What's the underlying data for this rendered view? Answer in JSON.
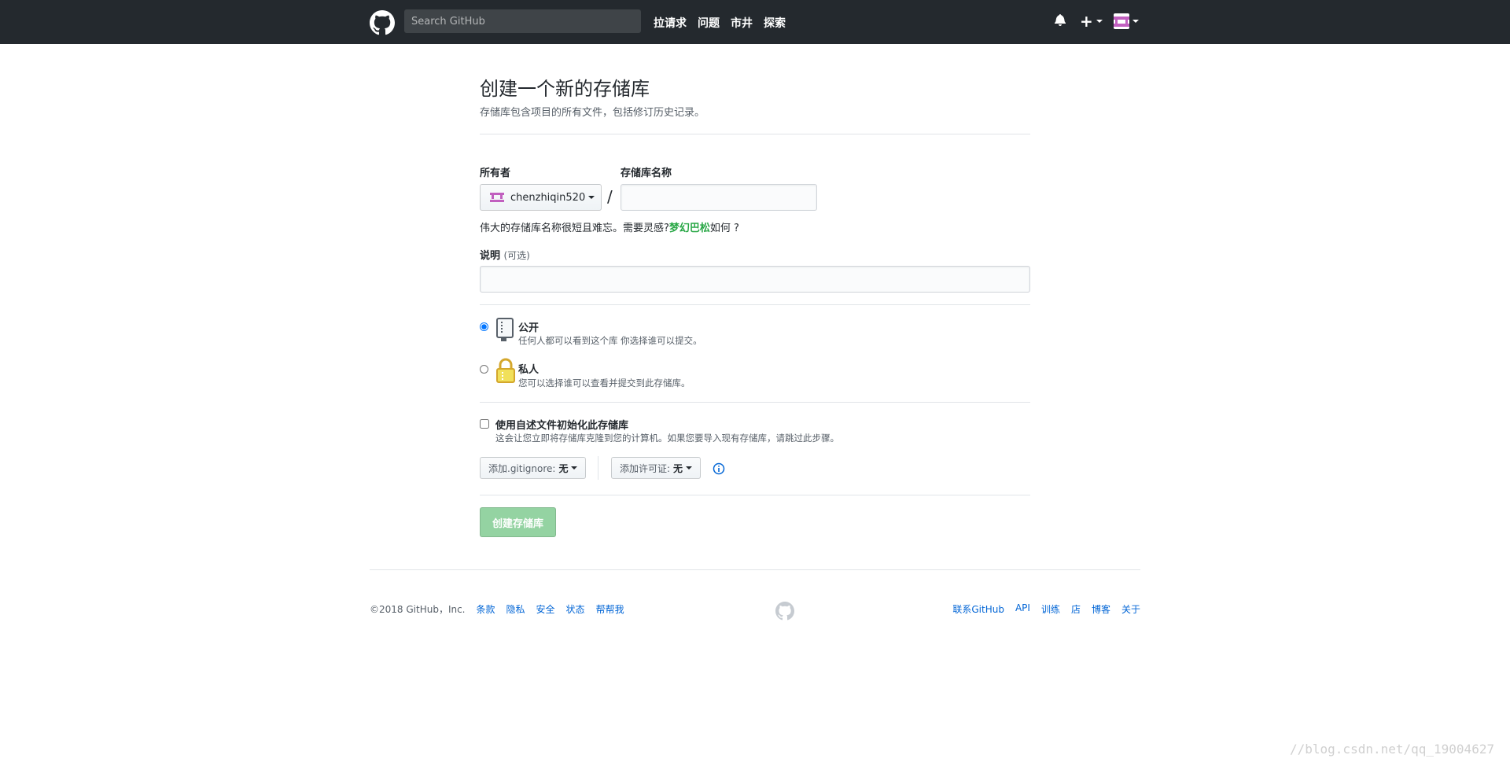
{
  "header": {
    "search_placeholder": "Search GitHub",
    "nav": [
      "拉请求",
      "问题",
      "市井",
      "探索"
    ]
  },
  "page": {
    "title": "创建一个新的存储库",
    "subtitle": "存储库包含项目的所有文件，包括修订历史记录。"
  },
  "form": {
    "owner_label": "所有者",
    "owner_value": "chenzhiqin520",
    "slash": "/",
    "repo_name_label": "存储库名称",
    "repo_name_value": "",
    "hint_prefix": "伟大的存储库名称很短且难忘。需要灵感?",
    "hint_suggestion": "梦幻巴松",
    "hint_suffix": "如何 ?",
    "description_label": "说明",
    "description_optional": "(可选)",
    "description_value": "",
    "public_label": "公开",
    "public_note": "任何人都可以看到这个库 你选择谁可以提交。",
    "public_selected": true,
    "private_label": "私人",
    "private_note": "您可以选择谁可以查看并提交到此存储库。",
    "init_label": "使用自述文件初始化此存储库",
    "init_note": "这会让您立即将存储库克隆到您的计算机。如果您要导入现有存储库，请跳过此步骤。",
    "init_checked": false,
    "gitignore_label": "添加.gitignore:",
    "gitignore_value": "无",
    "license_label": "添加许可证:",
    "license_value": "无",
    "create_button": "创建存储库"
  },
  "footer": {
    "copyright": "©2018 GitHub，Inc.",
    "left_links": [
      "条款",
      "隐私",
      "安全",
      "状态",
      "帮帮我"
    ],
    "right_links": [
      "联系GitHub",
      "API",
      "训练",
      "店",
      "博客",
      "关于"
    ]
  },
  "watermark": "//blog.csdn.net/qq_19004627",
  "colors": {
    "header_bg": "#24292e",
    "create_button_bg": "#94d3a2",
    "link": "#0366d6",
    "suggestion": "#28a745",
    "avatar": "#c15fbf"
  }
}
